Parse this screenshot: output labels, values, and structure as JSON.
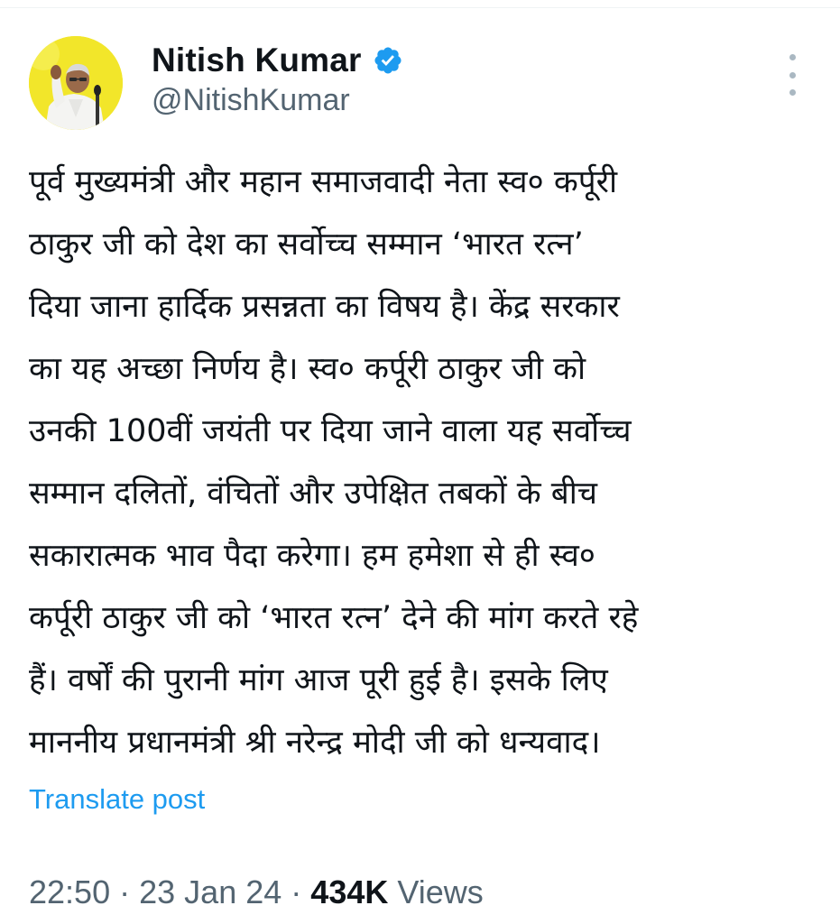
{
  "author": {
    "display_name": "Nitish Kumar",
    "handle": "@NitishKumar"
  },
  "post": {
    "lines": [
      "पूर्व मुख्यमंत्री और महान समाजवादी नेता स्व० कर्पूरी",
      "ठाकुर जी को देश का सर्वोच्च सम्मान ‘भारत रत्न’",
      "दिया जाना हार्दिक प्रसन्नता का विषय है। केंद्र सरकार",
      "का यह अच्छा निर्णय है। स्व० कर्पूरी ठाकुर जी को",
      "उनकी 100वीं जयंती पर दिया जाने वाला यह सर्वोच्च",
      "सम्मान दलितों, वंचितों और उपेक्षित तबकों के बीच",
      "सकारात्मक भाव पैदा करेगा। हम हमेशा से ही स्व०",
      "कर्पूरी ठाकुर जी को ‘भारत रत्न’ देने की मांग करते रहे",
      "हैं। वर्षों की पुरानी मांग आज पूरी हुई है। इसके लिए",
      "माननीय प्रधानमंत्री श्री नरेन्द्र मोदी जी को धन्यवाद।"
    ],
    "translate_label": "Translate post"
  },
  "meta": {
    "time": "22:50",
    "separator": "·",
    "date": "23 Jan 24",
    "views_count": "434K",
    "views_label": "Views"
  },
  "icons": {
    "verified": "verified-badge-icon",
    "more": "more-options-icon"
  },
  "colors": {
    "link": "#1d9bf0",
    "secondary_text": "#536471",
    "primary_text": "#0f1419",
    "avatar_bg": "#f2e62a",
    "verified_badge": "#1d9bf0"
  }
}
